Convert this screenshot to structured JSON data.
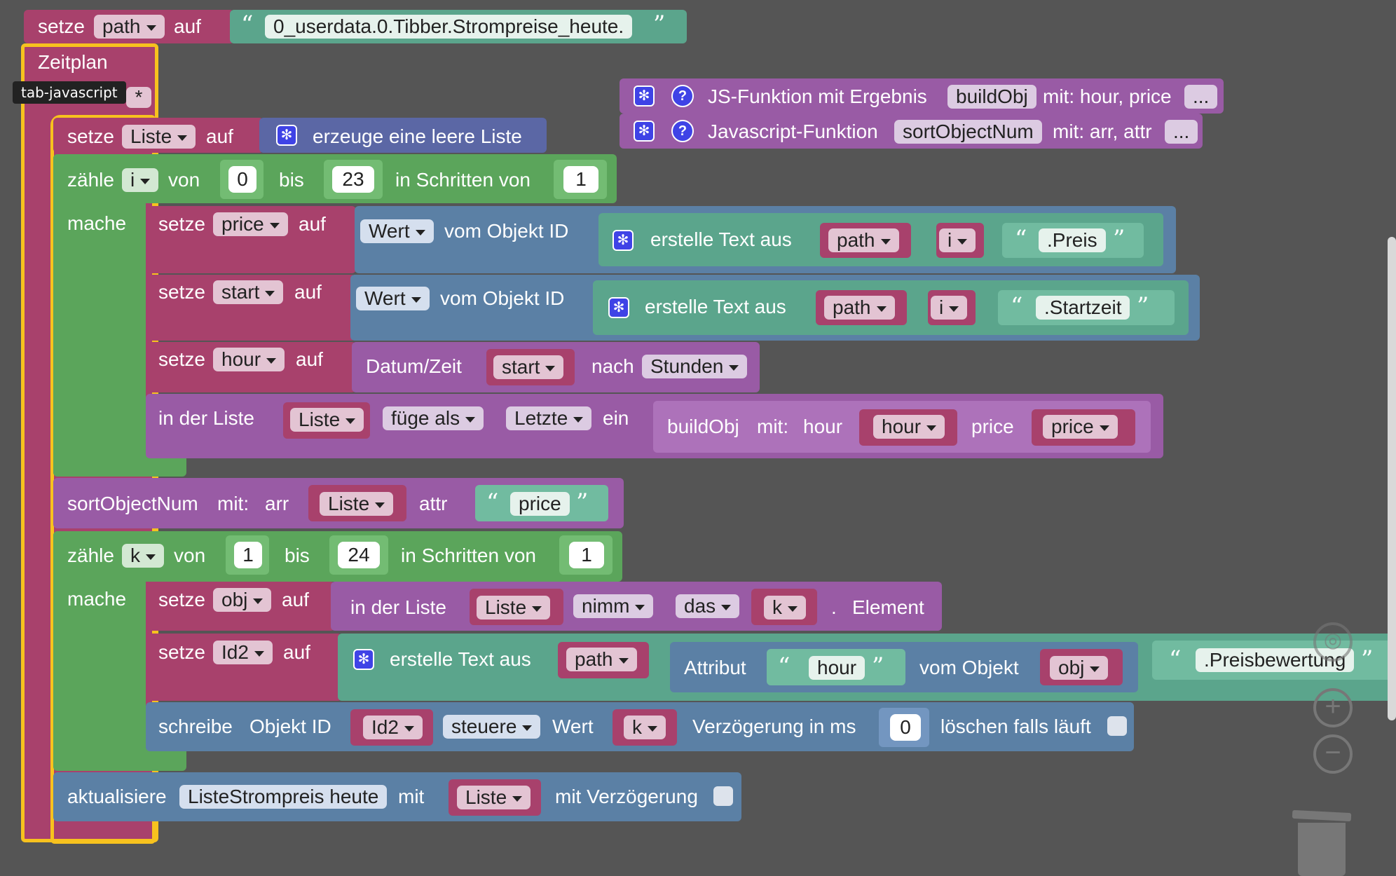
{
  "tooltip": "tab-javascript",
  "b1": {
    "setze": "setze",
    "var": "path",
    "auf": "auf",
    "q_open": "“",
    "value": "0_userdata.0.Tibber.Strompreise_heute.",
    "q_close": "”"
  },
  "schedule": {
    "label": "Zeitplan",
    "star": "*"
  },
  "func1": {
    "label": "JS-Funktion mit Ergebnis",
    "name": "buildObj",
    "params": "mit: hour, price",
    "more": "..."
  },
  "func2": {
    "label": "Javascript-Funktion",
    "name": "sortObjectNum",
    "params": "mit: arr, attr",
    "more": "..."
  },
  "b_liste": {
    "setze": "setze",
    "var": "Liste",
    "auf": "auf",
    "create": "erzeuge eine leere Liste"
  },
  "loop1": {
    "zaehle": "zähle",
    "var": "i",
    "von": "von",
    "from": "0",
    "bis": "bis",
    "to": "23",
    "step_label": "in Schritten von",
    "step": "1",
    "mache": "mache"
  },
  "set_price": {
    "setze": "setze",
    "var": "price",
    "auf": "auf",
    "wert": "Wert",
    "vom": "vom Objekt ID",
    "create": "erstelle Text aus",
    "a": "path",
    "b": "i",
    "q_open": "“",
    "c": ".Preis",
    "q_close": "”"
  },
  "set_start": {
    "setze": "setze",
    "var": "start",
    "auf": "auf",
    "wert": "Wert",
    "vom": "vom Objekt ID",
    "create": "erstelle Text aus",
    "a": "path",
    "b": "i",
    "q_open": "“",
    "c": ".Startzeit",
    "q_close": "”"
  },
  "set_hour": {
    "setze": "setze",
    "var": "hour",
    "auf": "auf",
    "dt": "Datum/Zeit",
    "v": "start",
    "nach": "nach",
    "unit": "Stunden"
  },
  "insert": {
    "in": "in der Liste",
    "list": "Liste",
    "mode": "füge als",
    "pos": "Letzte",
    "ein": "ein",
    "fn": "buildObj",
    "mit": "mit:",
    "p1": "hour",
    "v1": "hour",
    "p2": "price",
    "v2": "price"
  },
  "sort": {
    "fn": "sortObjectNum",
    "mit": "mit:",
    "p1": "arr",
    "v1": "Liste",
    "p2": "attr",
    "q_open": "“",
    "v2": "price",
    "q_close": "”"
  },
  "loop2": {
    "zaehle": "zähle",
    "var": "k",
    "von": "von",
    "from": "1",
    "bis": "bis",
    "to": "24",
    "step_label": "in Schritten von",
    "step": "1",
    "mache": "mache"
  },
  "set_obj": {
    "setze": "setze",
    "var": "obj",
    "auf": "auf",
    "in": "in der Liste",
    "list": "Liste",
    "take": "nimm",
    "das": "das",
    "k": "k",
    "dot": ".",
    "element": "Element"
  },
  "set_id2": {
    "setze": "setze",
    "var": "Id2",
    "auf": "auf",
    "create": "erstelle Text aus",
    "a": "path",
    "attr": "Attribut",
    "q_open": "“",
    "attr_v": "hour",
    "q_close": "”",
    "vom": "vom Objekt",
    "obj": "obj",
    "c": ".Preisbewertung"
  },
  "write": {
    "schreibe": "schreibe",
    "oid": "Objekt ID",
    "id": "Id2",
    "mode": "steuere",
    "wert": "Wert",
    "k": "k",
    "delay": "Verzögerung in ms",
    "delay_v": "0",
    "clear": "löschen falls läuft"
  },
  "update": {
    "label": "aktualisiere",
    "name": "ListeStrompreis heute",
    "mit": "mit",
    "list": "Liste",
    "delay": "mit Verzögerung"
  },
  "icons": {
    "gear": "gear-icon",
    "help": "help-icon",
    "zoom_in": "zoom-in-icon",
    "zoom_out": "zoom-out-icon",
    "trash": "trash-icon",
    "reset": "reset-zoom-icon"
  },
  "colors": {
    "variable": "#a8416c",
    "loop": "#5ba55b",
    "object": "#5b80a5",
    "text": "#5ba58c",
    "procedure": "#995ba5",
    "selection": "#f7c21e",
    "workspace": "#555555"
  }
}
